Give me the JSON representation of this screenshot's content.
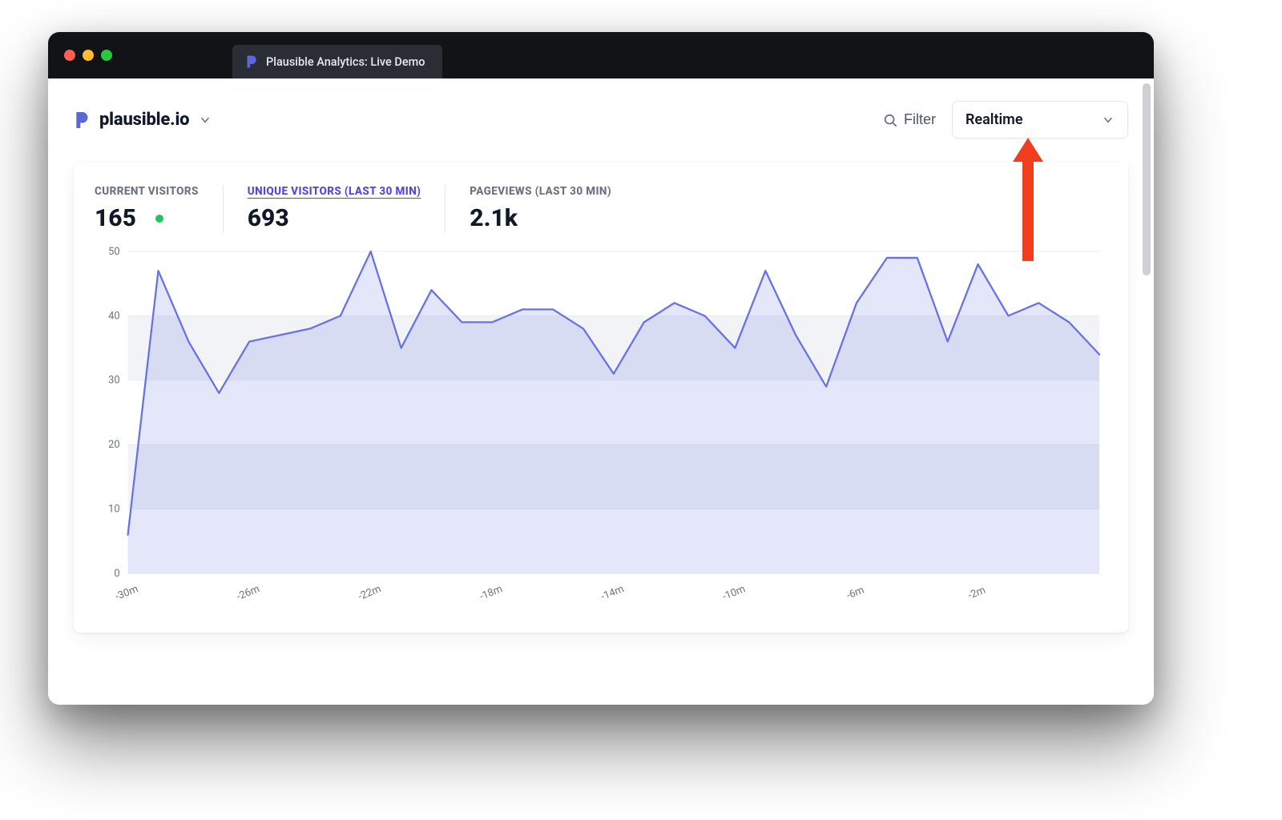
{
  "browser": {
    "tab_title": "Plausible Analytics: Live Demo"
  },
  "header": {
    "site_name": "plausible.io",
    "filter_label": "Filter",
    "range_label": "Realtime"
  },
  "stats": {
    "current_visitors": {
      "label": "CURRENT VISITORS",
      "value": "165"
    },
    "unique_visitors": {
      "label": "UNIQUE VISITORS (LAST 30 MIN)",
      "value": "693"
    },
    "pageviews": {
      "label": "PAGEVIEWS (LAST 30 MIN)",
      "value": "2.1k"
    }
  },
  "chart_data": {
    "type": "line",
    "title": "",
    "xlabel": "",
    "ylabel": "",
    "ylim": [
      0,
      50
    ],
    "y_ticks": [
      0,
      10,
      20,
      30,
      40,
      50
    ],
    "x_tick_labels": [
      "-30m",
      "-26m",
      "-22m",
      "-18m",
      "-14m",
      "-10m",
      "-6m",
      "-2m"
    ],
    "x_tick_positions": [
      0,
      4,
      8,
      12,
      16,
      20,
      24,
      28
    ],
    "categories_minutes_ago": [
      30,
      29,
      28,
      27,
      26,
      25,
      24,
      23,
      22,
      21,
      20,
      19,
      18,
      17,
      16,
      15,
      14,
      13,
      12,
      11,
      10,
      9,
      8,
      7,
      6,
      5,
      4,
      3,
      2,
      1
    ],
    "values": [
      6,
      47,
      36,
      28,
      36,
      37,
      38,
      40,
      50,
      35,
      44,
      39,
      39,
      41,
      41,
      38,
      31,
      39,
      42,
      40,
      35,
      47,
      37,
      29,
      42,
      49,
      49,
      36,
      48,
      40,
      42,
      39,
      34
    ]
  },
  "colors": {
    "accent": "#6772e5",
    "text_primary": "#111827",
    "text_secondary": "#6b7280",
    "annotation_arrow": "#ef3d1e"
  }
}
